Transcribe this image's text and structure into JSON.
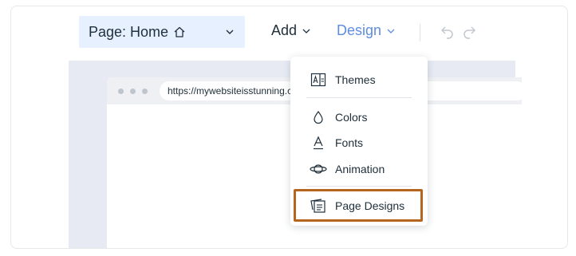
{
  "toolbar": {
    "page_select_label": "Page: Home",
    "add_label": "Add",
    "design_label": "Design"
  },
  "browser": {
    "url": "https://mywebsiteisstunning.com"
  },
  "design_menu": {
    "items": [
      {
        "label": "Themes",
        "icon": "themes-icon"
      },
      {
        "label": "Colors",
        "icon": "droplet-icon"
      },
      {
        "label": "Fonts",
        "icon": "font-icon"
      },
      {
        "label": "Animation",
        "icon": "planet-icon"
      },
      {
        "label": "Page Designs",
        "icon": "page-designs-icon"
      }
    ]
  },
  "colors": {
    "accent": "#5e8ce0",
    "page_select_bg": "#e7f0ff",
    "highlight": "#b5651d",
    "canvas_bg": "#e7eaf3"
  }
}
